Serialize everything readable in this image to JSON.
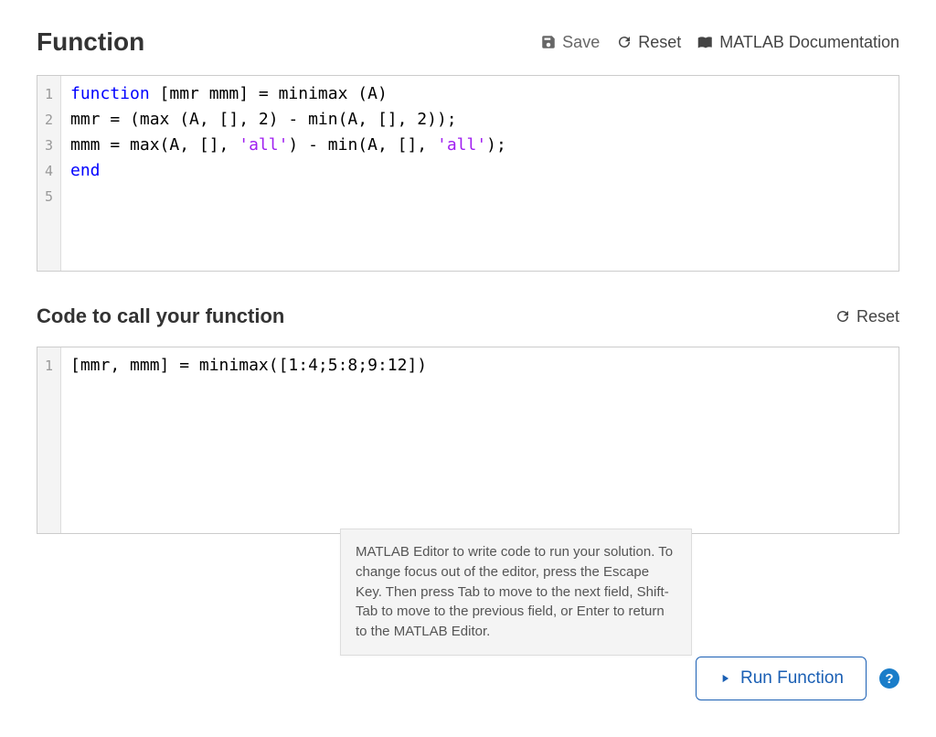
{
  "sections": {
    "function": {
      "title": "Function",
      "toolbar": {
        "save_label": "Save",
        "reset_label": "Reset",
        "doc_label": "MATLAB Documentation"
      },
      "code": {
        "lines": [
          {
            "n": "1",
            "tokens": [
              {
                "cls": "kw",
                "t": "function"
              },
              {
                "cls": "plain",
                "t": " [mmr mmm] = minimax (A)"
              }
            ]
          },
          {
            "n": "2",
            "tokens": [
              {
                "cls": "plain",
                "t": "mmr = (max (A, [], 2) - min(A, [], 2));"
              }
            ]
          },
          {
            "n": "3",
            "tokens": [
              {
                "cls": "plain",
                "t": "mmm = max(A, [], "
              },
              {
                "cls": "str",
                "t": "'all'"
              },
              {
                "cls": "plain",
                "t": ") - min(A, [], "
              },
              {
                "cls": "str",
                "t": "'all'"
              },
              {
                "cls": "plain",
                "t": ");"
              }
            ]
          },
          {
            "n": "4",
            "tokens": [
              {
                "cls": "kw",
                "t": "end"
              }
            ]
          },
          {
            "n": "5",
            "tokens": []
          }
        ]
      }
    },
    "caller": {
      "title": "Code to call your function",
      "toolbar": {
        "reset_label": "Reset"
      },
      "code": {
        "lines": [
          {
            "n": "1",
            "tokens": [
              {
                "cls": "plain",
                "t": "[mmr, mmm] = minimax([1:4;5:8;9:12])"
              }
            ]
          }
        ]
      }
    }
  },
  "tooltip_text": "MATLAB Editor to write code to run your solution. To change focus out of the editor, press the Escape Key. Then press Tab to move to the next field, Shift-Tab to move to the previous field, or Enter to return to the MATLAB Editor.",
  "run_button_label": "Run Function",
  "help_label": "?"
}
